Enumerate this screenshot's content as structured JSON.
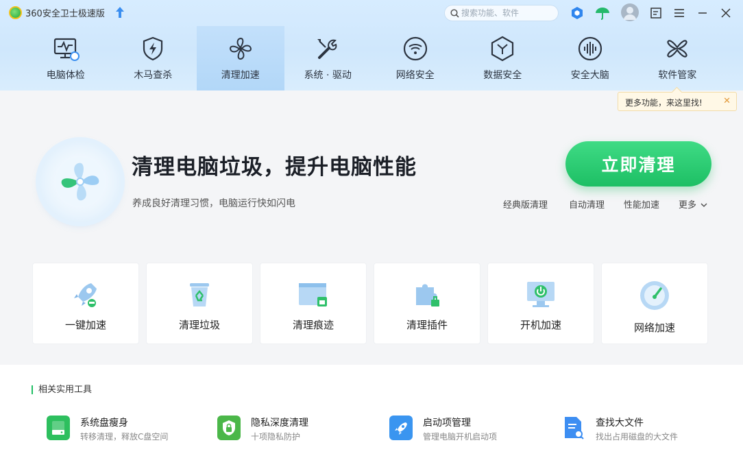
{
  "app": {
    "title": "360安全卫士极速版"
  },
  "search": {
    "placeholder": "搜索功能、软件"
  },
  "nav": [
    {
      "label": "电脑体检",
      "icon": "monitor-check-icon"
    },
    {
      "label": "木马查杀",
      "icon": "shield-bolt-icon"
    },
    {
      "label": "清理加速",
      "icon": "fan-icon",
      "active": true
    },
    {
      "label": "系统 · 驱动",
      "icon": "wrench-icon"
    },
    {
      "label": "网络安全",
      "icon": "wifi-icon"
    },
    {
      "label": "数据安全",
      "icon": "hexagon-y-icon"
    },
    {
      "label": "安全大脑",
      "icon": "brain-icon"
    },
    {
      "label": "软件管家",
      "icon": "clover-icon"
    }
  ],
  "tooltip": {
    "text": "更多功能，来这里找!"
  },
  "hero": {
    "title": "清理电脑垃圾，提升电脑性能",
    "subtitle": "养成良好清理习惯，电脑运行快如闪电",
    "button": "立即清理",
    "links": [
      "经典版清理",
      "自动清理",
      "性能加速",
      "更多"
    ]
  },
  "cards": [
    {
      "label": "一键加速",
      "icon": "rocket-icon"
    },
    {
      "label": "清理垃圾",
      "icon": "recycle-bin-icon"
    },
    {
      "label": "清理痕迹",
      "icon": "browser-trace-icon"
    },
    {
      "label": "清理插件",
      "icon": "puzzle-icon"
    },
    {
      "label": "开机加速",
      "icon": "power-monitor-icon"
    },
    {
      "label": "网络加速",
      "icon": "speedometer-icon"
    }
  ],
  "related": {
    "heading": "相关实用工具",
    "tools": [
      {
        "name": "系统盘瘦身",
        "desc": "转移清理，释放C盘空间",
        "icon": "disk-icon",
        "color": "#2dbf5e"
      },
      {
        "name": "隐私深度清理",
        "desc": "十项隐私防护",
        "icon": "privacy-shield-icon",
        "color": "#4bb749"
      },
      {
        "name": "启动项管理",
        "desc": "管理电脑开机启动项",
        "icon": "startup-rocket-icon",
        "color": "#3a95f0"
      },
      {
        "name": "查找大文件",
        "desc": "找出占用磁盘的大文件",
        "icon": "file-search-icon",
        "color": "#3d8ef2"
      }
    ]
  }
}
